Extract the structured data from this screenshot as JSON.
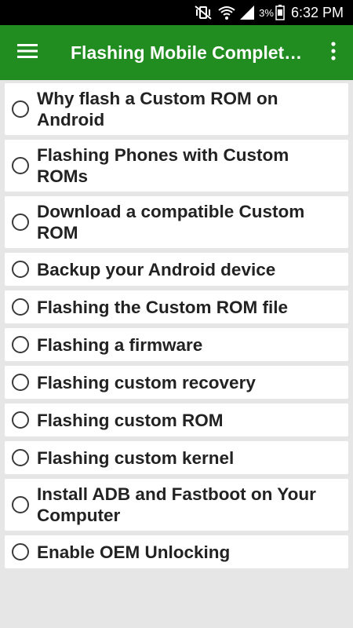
{
  "status_bar": {
    "battery_percent": "3%",
    "time": "6:32 PM",
    "icons": [
      "mute-vibrate-icon",
      "wifi-icon",
      "signal-icon",
      "battery-icon"
    ]
  },
  "app_bar": {
    "title": "Flashing Mobile Complet…",
    "menu_icon": "hamburger-menu-icon",
    "more_icon": "more-vertical-icon",
    "color": "#218c1f"
  },
  "items": [
    {
      "label": "Why flash a Custom ROM on Android"
    },
    {
      "label": "Flashing Phones with Custom ROMs"
    },
    {
      "label": "Download a compatible Custom ROM"
    },
    {
      "label": "Backup your Android device"
    },
    {
      "label": "Flashing the Custom ROM file"
    },
    {
      "label": "Flashing a firmware"
    },
    {
      "label": "Flashing custom recovery"
    },
    {
      "label": "Flashing custom ROM"
    },
    {
      "label": "Flashing custom kernel"
    },
    {
      "label": "Install ADB and Fastboot on Your Computer"
    },
    {
      "label": "Enable OEM Unlocking"
    }
  ]
}
